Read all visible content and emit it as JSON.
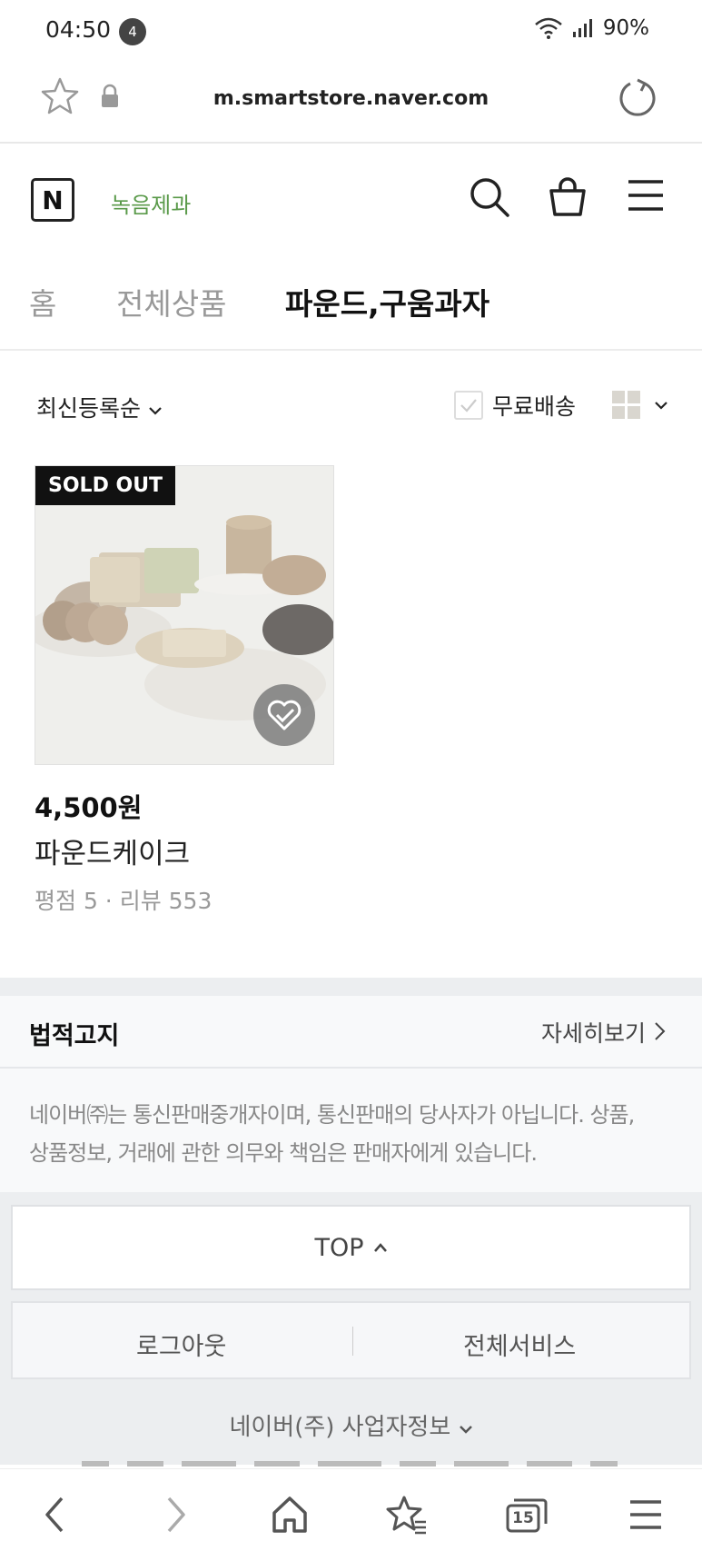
{
  "status": {
    "time": "04:50",
    "notification_count": "4",
    "battery": "90%"
  },
  "browser": {
    "url": "m.smartstore.naver.com"
  },
  "store": {
    "logo_letter": "N",
    "name": "녹음제과"
  },
  "tabs": [
    {
      "label": "홈"
    },
    {
      "label": "전체상품"
    },
    {
      "label": "파운드,구움과자"
    }
  ],
  "filter": {
    "sort_label": "최신등록순",
    "free_shipping_label": "무료배송"
  },
  "product": {
    "badge": "SOLD OUT",
    "price": "4,500원",
    "name": "파운드케이크",
    "meta": "평점 5 · 리뷰 553"
  },
  "legal": {
    "title": "법적고지",
    "more_label": "자세히보기",
    "notice_line1": "네이버㈜는 통신판매중개자이며, 통신판매의 당사자가 아닙니다. 상품,",
    "notice_line2": "상품정보, 거래에 관한 의무와 책임은 판매자에게 있습니다."
  },
  "footer": {
    "top_label": "TOP",
    "logout_label": "로그아웃",
    "all_services_label": "전체서비스",
    "biz_info_label": "네이버(주) 사업자정보"
  },
  "bottom_nav": {
    "tab_count": "15"
  },
  "colors": {
    "store_name": "#5a9a4a",
    "badge_bg": "#111111"
  }
}
